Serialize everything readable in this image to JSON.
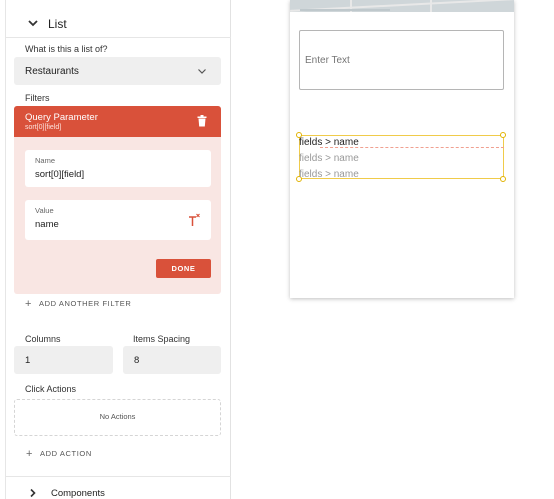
{
  "panel": {
    "section_title": "List",
    "list_of_label": "What is this a list of?",
    "list_of_value": "Restaurants",
    "filters_label": "Filters",
    "filter": {
      "title": "Query Parameter",
      "subtitle": "sort[0][field]",
      "name_label": "Name",
      "name_value": "sort[0][field]",
      "value_label": "Value",
      "value_value": "name",
      "done_label": "DONE"
    },
    "add_filter_label": "ADD ANOTHER FILTER",
    "columns_label": "Columns",
    "columns_value": "1",
    "spacing_label": "Items Spacing",
    "spacing_value": "8",
    "click_actions_label": "Click Actions",
    "no_actions_text": "No Actions",
    "add_action_label": "ADD ACTION",
    "components_title": "Components"
  },
  "preview": {
    "input_placeholder": "Enter Text",
    "list_items": [
      "fields > name",
      "fields > name",
      "fields > name"
    ]
  },
  "colors": {
    "accent": "#d9513a",
    "accent_light": "#f9e6e3",
    "selection": "#f0cb4a"
  }
}
